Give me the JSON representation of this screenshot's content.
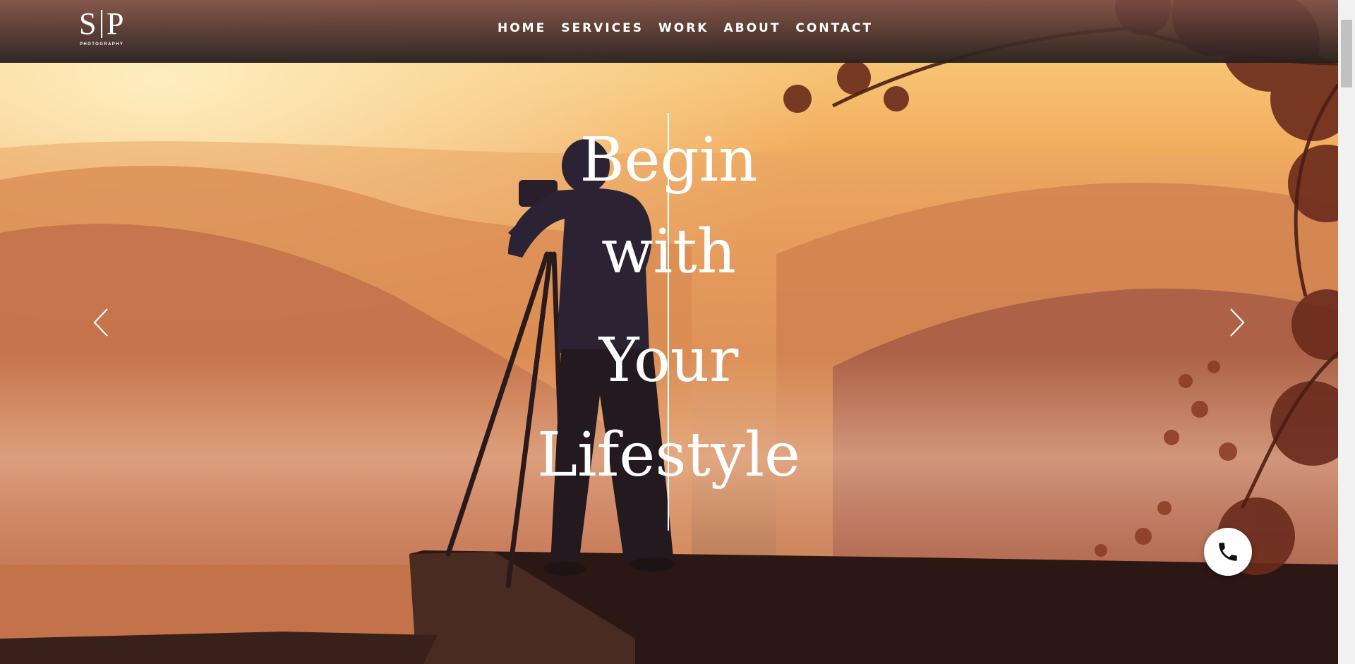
{
  "brand": {
    "logo_left": "S",
    "logo_right": "P",
    "logo_sub": "PHOTOGRAPHY"
  },
  "nav": {
    "items": [
      {
        "label": "HOME"
      },
      {
        "label": "SERVICES"
      },
      {
        "label": "WORK"
      },
      {
        "label": "ABOUT"
      },
      {
        "label": "CONTACT"
      }
    ]
  },
  "hero": {
    "headline_lines": [
      "Begin",
      "with",
      "Your",
      "Lifestyle"
    ],
    "prev_icon": "chevron-left-icon",
    "next_icon": "chevron-right-icon"
  },
  "contact": {
    "phone_icon": "phone-icon"
  },
  "colors": {
    "sky_top": "#f7cf82",
    "sky_mid": "#e99a55",
    "ground": "#3a1f1a",
    "header": "#3a2a27",
    "text": "#ffffff"
  }
}
